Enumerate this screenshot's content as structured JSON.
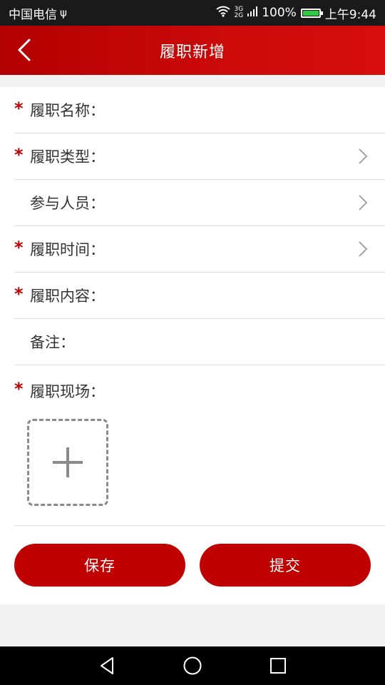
{
  "status_bar": {
    "carrier": "中国电信",
    "usb_symbol": "ψ",
    "network_top": "3G",
    "network_bottom": "2G",
    "battery_percent": "100%",
    "battery_level": 1.0,
    "time": "上午9:44"
  },
  "header": {
    "title": "履职新增"
  },
  "form": {
    "fields": [
      {
        "label": "履职名称：",
        "required": true,
        "has_chevron": false
      },
      {
        "label": "履职类型：",
        "required": true,
        "has_chevron": true
      },
      {
        "label": "参与人员：",
        "required": false,
        "has_chevron": true
      },
      {
        "label": "履职时间：",
        "required": true,
        "has_chevron": true
      },
      {
        "label": "履职内容：",
        "required": true,
        "has_chevron": false
      },
      {
        "label": "备注：",
        "required": false,
        "has_chevron": false
      }
    ],
    "photo_label": "履职现场：",
    "required_symbol": "*"
  },
  "actions": {
    "save_label": "保存",
    "submit_label": "提交"
  },
  "colors": {
    "brand_red": "#c00000",
    "status_bar": "#1a1a1a",
    "divider": "#dcdcdc"
  }
}
